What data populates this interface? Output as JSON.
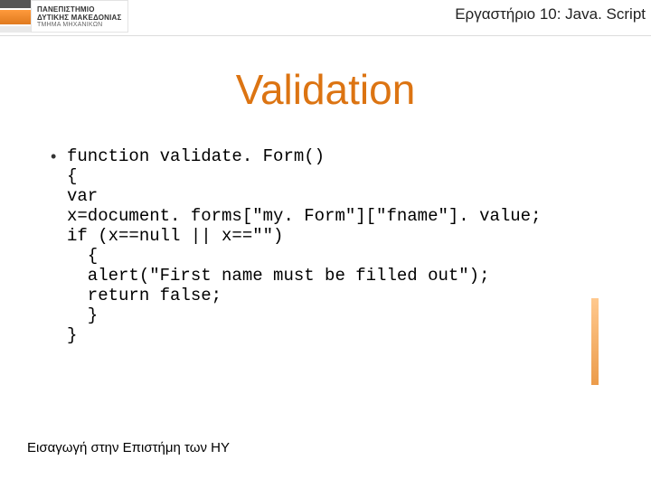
{
  "header": {
    "logo_line1": "ΠΑΝΕΠΙΣΤΗΜΙΟ",
    "logo_line2": "ΔΥΤΙΚΗΣ ΜΑΚΕΔΟΝΙΑΣ",
    "logo_line3": "ΤΜΗΜΑ ΜΗΧΑΝΙΚΩΝ",
    "lab_title": "Εργαστήριο 10: Java. Script"
  },
  "title": "Validation",
  "code": "function validate. Form()\n{\nvar\nx=document. forms[\"my. Form\"][\"fname\"]. value;\nif (x==null || x==\"\")\n  {\n  alert(\"First name must be filled out\");\n  return false;\n  }\n}",
  "bullet": "•",
  "footer": "Εισαγωγή στην Επιστήμη των ΗΥ"
}
